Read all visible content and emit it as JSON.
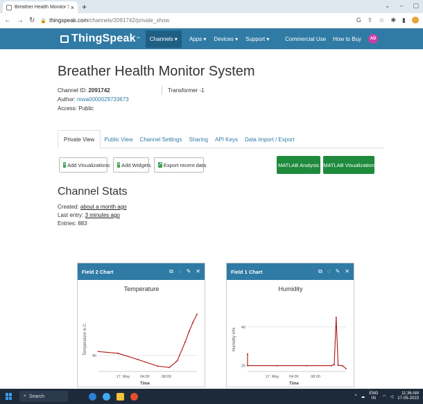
{
  "browser": {
    "tab_title": "Breather Health Monitor System",
    "new_tab": "+",
    "url_host": "thingspeak.com",
    "url_path": "/channels/2091742/private_show"
  },
  "nav": {
    "logo": "ThingSpeak",
    "logo_tm": "™",
    "channels": "Channels ▾",
    "apps": "Apps ▾",
    "devices": "Devices ▾",
    "support": "Support ▾",
    "commercial": "Commercial Use",
    "how_to_buy": "How to Buy",
    "avatar": "AD"
  },
  "channel": {
    "title": "Breather Health Monitor System",
    "id_label": "Channel ID: ",
    "id_value": "2091742",
    "author_label": "Author: ",
    "author_value": "mwa0000029733673",
    "access": "Access: Public",
    "tag": "Transformer -1"
  },
  "tabs": [
    "Private View",
    "Public View",
    "Channel Settings",
    "Sharing",
    "API Keys",
    "Data Import / Export"
  ],
  "buttons": {
    "add_visualizations": "Add Visualizations",
    "add_widgets": "Add Widgets",
    "export": "Export recent data",
    "matlab_analysis": "MATLAB Analysis",
    "matlab_visualization": "MATLAB Visualization"
  },
  "stats": {
    "title": "Channel Stats",
    "created_label": "Created: ",
    "created_value": "about a month ago",
    "last_entry_label": "Last entry: ",
    "last_entry_value": "3 minutes ago",
    "entries": "Entries: 883"
  },
  "widgets": [
    {
      "header": "Field 2 Chart"
    },
    {
      "header": "Field 1 Chart"
    }
  ],
  "chart_data": [
    {
      "type": "line",
      "title": "Temperature",
      "xlabel": "Time",
      "ylabel": "Temperature in C",
      "x_ticks": [
        "17. May",
        "04:00",
        "08:00"
      ],
      "y_ticks": [
        40
      ],
      "ylim": [
        34,
        58
      ],
      "grid": true,
      "color": "#b22222",
      "series": [
        {
          "points": [
            [
              0.0,
              41.5
            ],
            [
              0.2,
              40.8
            ],
            [
              0.4,
              38.5
            ],
            [
              0.6,
              36.0
            ],
            [
              0.72,
              35.5
            ],
            [
              0.8,
              38.0
            ],
            [
              0.88,
              45.0
            ],
            [
              0.92,
              49.0
            ],
            [
              0.96,
              52.5
            ],
            [
              1.0,
              55.5
            ]
          ]
        }
      ]
    },
    {
      "type": "line",
      "title": "Humidity",
      "xlabel": "Time",
      "ylabel": "Humidity in%",
      "x_ticks": [
        "17. May",
        "04:00",
        "08:00"
      ],
      "y_ticks": [
        20,
        40
      ],
      "ylim": [
        17,
        50
      ],
      "grid": true,
      "color": "#b22222",
      "series": [
        {
          "points": [
            [
              0.0,
              26.0
            ],
            [
              0.0,
              20.0
            ],
            [
              0.3,
              20.0
            ],
            [
              0.6,
              20.0
            ],
            [
              0.85,
              20.0
            ],
            [
              0.88,
              20.5
            ],
            [
              0.9,
              45.0
            ],
            [
              0.92,
              20.2
            ],
            [
              0.96,
              20.0
            ],
            [
              1.0,
              18.5
            ]
          ]
        }
      ]
    }
  ],
  "taskbar": {
    "search": "Search",
    "lang1": "ENG",
    "lang2": "IN",
    "time": "11:36 AM",
    "date": "17-05-2023"
  }
}
